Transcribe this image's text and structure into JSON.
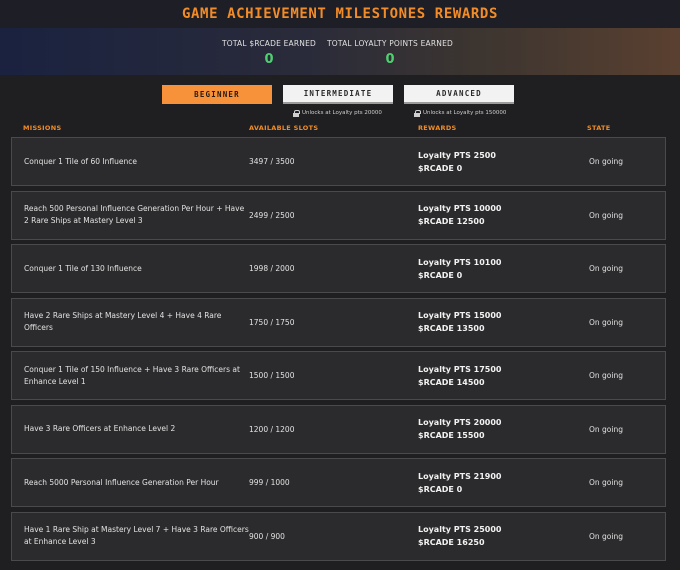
{
  "title": "GAME ACHIEVEMENT MILESTONES REWARDS",
  "stats": {
    "rcade_label": "TOTAL $RCADE EARNED",
    "rcade_value": "0",
    "loyalty_label": "TOTAL LOYALTY POINTS EARNED",
    "loyalty_value": "0"
  },
  "tabs": [
    {
      "label": "BEGINNER",
      "selected": true
    },
    {
      "label": "INTERMEDIATE",
      "unlock": "Unlocks at Loyalty pts 20000"
    },
    {
      "label": "ADVANCED",
      "unlock": "Unlocks at Loyalty pts 150000"
    }
  ],
  "columns": {
    "missions": "MISSIONS",
    "slots": "AVAILABLE SLOTS",
    "rewards": "REWARDS",
    "state": "STATE"
  },
  "rows": [
    {
      "mission": "Conquer 1 Tile of 60 Influence",
      "slots": "3497 / 3500",
      "loyalty": "Loyalty PTS 2500",
      "rcade": "$RCADE 0",
      "state": "On going"
    },
    {
      "mission": "Reach 500 Personal Influence Generation Per Hour + Have 2 Rare Ships at Mastery Level 3",
      "slots": "2499 / 2500",
      "loyalty": "Loyalty PTS 10000",
      "rcade": "$RCADE 12500",
      "state": "On going"
    },
    {
      "mission": "Conquer 1 Tile of 130 Influence",
      "slots": "1998 / 2000",
      "loyalty": "Loyalty PTS 10100",
      "rcade": "$RCADE 0",
      "state": "On going"
    },
    {
      "mission": "Have 2 Rare Ships at Mastery Level 4 + Have 4 Rare Officers",
      "slots": "1750 / 1750",
      "loyalty": "Loyalty PTS 15000",
      "rcade": "$RCADE 13500",
      "state": "On going"
    },
    {
      "mission": "Conquer 1 Tile of 150 Influence + Have 3 Rare Officers at Enhance Level 1",
      "slots": "1500 / 1500",
      "loyalty": "Loyalty PTS 17500",
      "rcade": "$RCADE 14500",
      "state": "On going"
    },
    {
      "mission": "Have 3 Rare Officers at Enhance Level 2",
      "slots": "1200 / 1200",
      "loyalty": "Loyalty PTS 20000",
      "rcade": "$RCADE 15500",
      "state": "On going"
    },
    {
      "mission": "Reach 5000 Personal Influence Generation Per Hour",
      "slots": "999 / 1000",
      "loyalty": "Loyalty PTS 21900",
      "rcade": "$RCADE 0",
      "state": "On going"
    },
    {
      "mission": "Have 1 Rare Ship at Mastery Level 7 + Have 3 Rare Officers at Enhance Level 3",
      "slots": "900 / 900",
      "loyalty": "Loyalty PTS 25000",
      "rcade": "$RCADE 16250",
      "state": "On going"
    }
  ],
  "colors": {
    "accent": "#f28c28",
    "value_green": "#4fd070",
    "row_bg": "#2b2b2d",
    "page_bg": "#1f1f21"
  },
  "icons": {
    "unlock": "lock-icon"
  }
}
